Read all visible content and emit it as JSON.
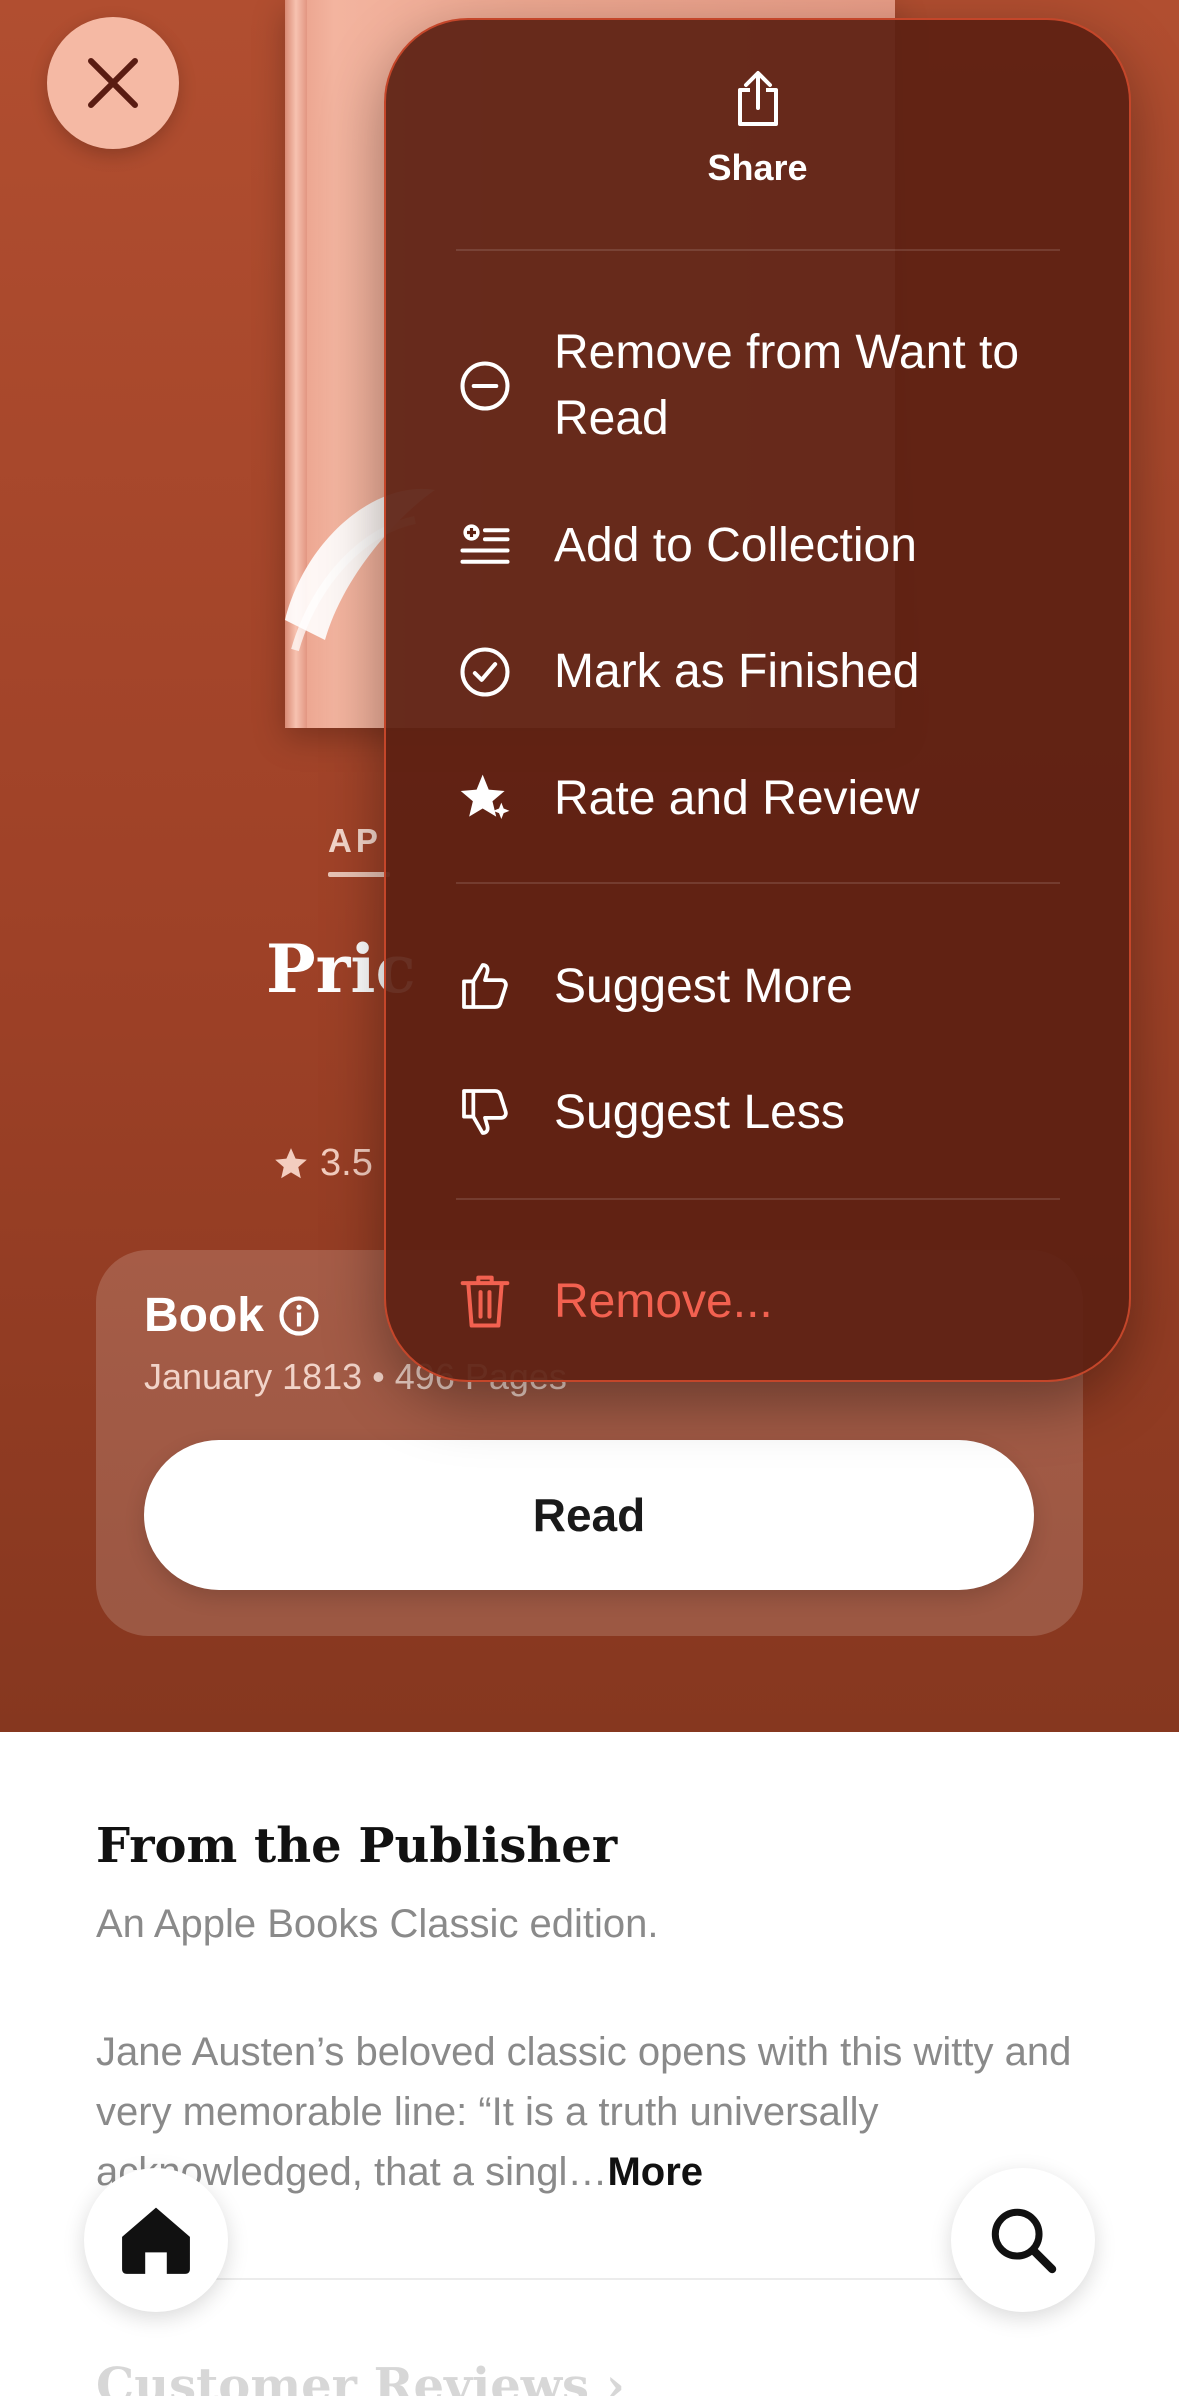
{
  "hero": {
    "series_label": "AP",
    "title": "Pric",
    "rating": "3.5",
    "book_type": "Book",
    "book_meta": "January 1813 • 496 Pages",
    "read_label": "Read"
  },
  "menu": {
    "share_label": "Share",
    "items": [
      {
        "label": "Remove from Want to Read",
        "icon": "minus-circle-icon"
      },
      {
        "label": "Add to Collection",
        "icon": "add-list-icon"
      },
      {
        "label": "Mark as Finished",
        "icon": "checkmark-circle-icon"
      },
      {
        "label": "Rate and Review",
        "icon": "star-sparkle-icon"
      },
      {
        "label": "Suggest More",
        "icon": "thumbs-up-icon"
      },
      {
        "label": "Suggest Less",
        "icon": "thumbs-down-icon"
      },
      {
        "label": "Remove...",
        "icon": "trash-icon"
      }
    ]
  },
  "publisher": {
    "heading": "From the Publisher",
    "line1": "An Apple Books Classic edition.",
    "line2": " Jane Austen’s beloved classic opens with this witty and very memorable line: “It is a truth universally acknowledged, that a singl…",
    "more": "More"
  },
  "reviews": {
    "heading": "Customer Reviews ›"
  },
  "colors": {
    "hero_bg": "#a4452a",
    "menu_bg": "#5c2012",
    "destructive": "#f26150"
  }
}
